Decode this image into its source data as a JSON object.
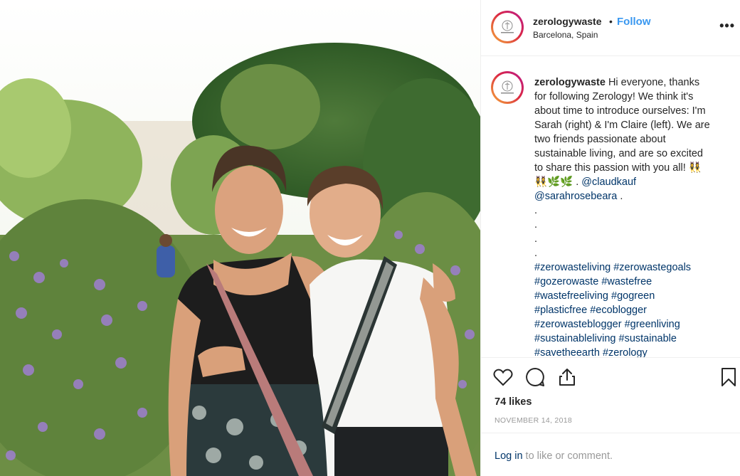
{
  "post": {
    "username": "zerologywaste",
    "separator": "•",
    "follow_label": "Follow",
    "location": "Barcelona, Spain",
    "more_label": "•••"
  },
  "caption": {
    "username": "zerologywaste",
    "lines": [
      " Hi everyone, thanks",
      "for following Zerology! We think it's",
      "about time to introduce ourselves: I'm",
      "Sarah (right) & I'm Claire (left). We are",
      "two friends passionate about",
      "sustainable living, and are so excited",
      "to share this passion with you all! 👯‍♀️"
    ],
    "emoji_line_prefix": "👯‍♀️🌿🌿 . ",
    "mention_1": "@claudkauf",
    "mention_2": "@sarahrosebeara",
    "mention_2_suffix": " .",
    "dots": [
      ".",
      ".",
      ".",
      "."
    ],
    "hashtag_lines": [
      [
        "#zerowasteliving",
        "#zerowastegoals"
      ],
      [
        "#gozerowaste",
        "#wastefree"
      ],
      [
        "#wastefreeliving",
        "#gogreen"
      ],
      [
        "#plasticfree",
        "#ecoblogger"
      ],
      [
        "#zerowasteblogger",
        "#greenliving"
      ],
      [
        "#sustainableliving",
        "#sustainable"
      ],
      [
        "#savetheearth",
        "#zerology"
      ]
    ]
  },
  "actions": {
    "like_icon": "heart-icon",
    "comment_icon": "comment-icon",
    "share_icon": "share-icon",
    "save_icon": "bookmark-icon",
    "likes_text": "74 likes",
    "date_text": "NOVEMBER 14, 2018"
  },
  "login": {
    "link_text": "Log in",
    "rest_text": " to like or comment."
  },
  "colors": {
    "link": "#003569",
    "follow": "#3897f0",
    "border": "#efefef",
    "muted": "#999999"
  }
}
